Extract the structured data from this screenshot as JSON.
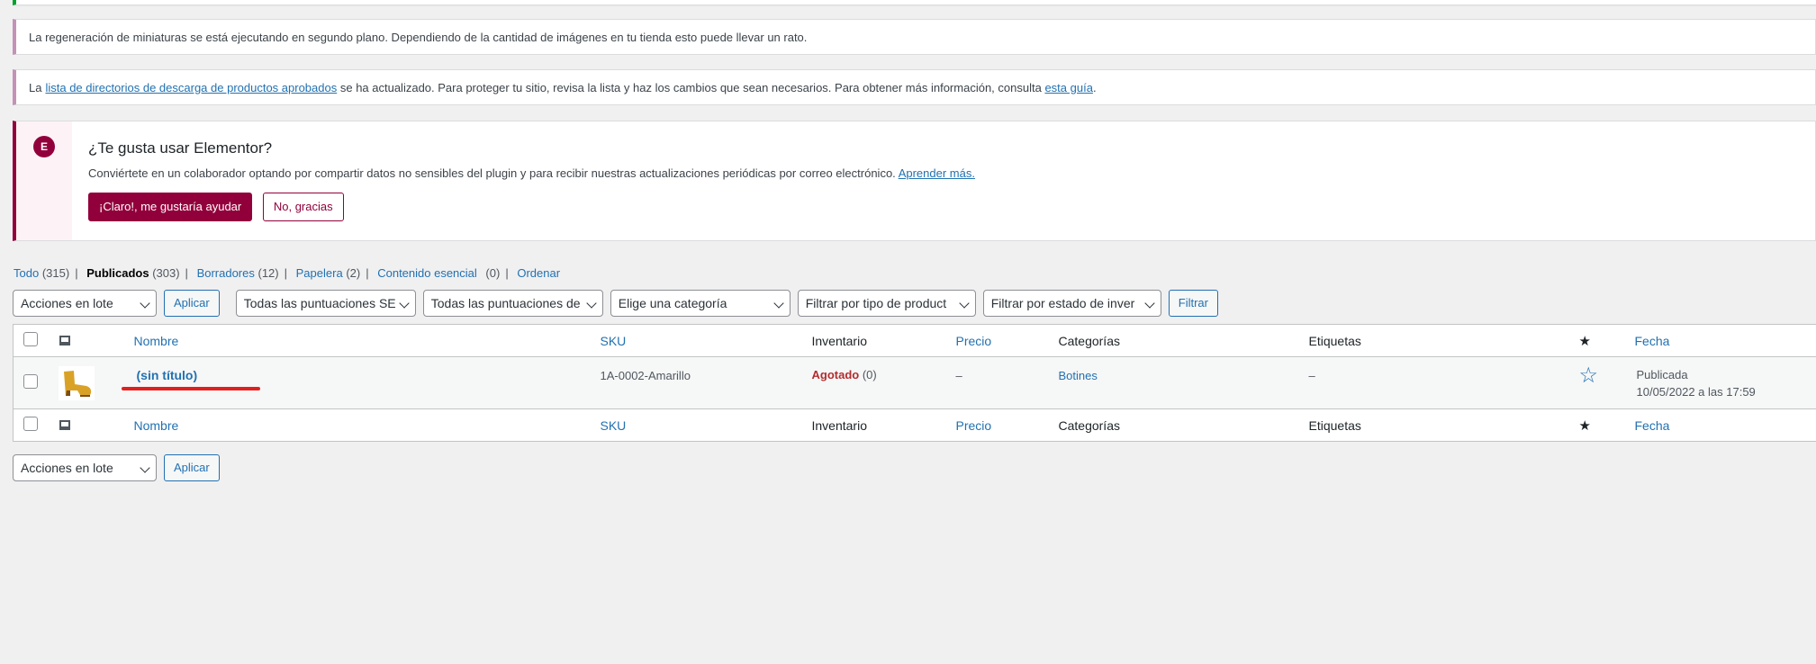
{
  "notices": {
    "thumbnail": "La regeneración de miniaturas se está ejecutando en segundo plano. Dependiendo de la cantidad de imágenes en tu tienda esto puede llevar un rato.",
    "downloads_prefix": "La ",
    "downloads_link": "lista de directorios de descarga de productos aprobados",
    "downloads_middle": " se ha actualizado. Para proteger tu sitio, revisa la lista y haz los cambios que sean necesarios. Para obtener más información, consulta ",
    "downloads_guide": "esta guía",
    "downloads_suffix": "."
  },
  "elementor": {
    "logo": "E",
    "title": "¿Te gusta usar Elementor?",
    "description": "Conviértete en un colaborador optando por compartir datos no sensibles del plugin y para recibir nuestras actualizaciones periódicas por correo electrónico. ",
    "learn_more": "Aprender más.",
    "accept": "¡Claro!, me gustaría ayudar",
    "decline": "No, gracias"
  },
  "views": [
    {
      "label": "Todo",
      "count": "(315)"
    },
    {
      "label": "Publicados",
      "count": "(303)"
    },
    {
      "label": "Borradores",
      "count": "(12)"
    },
    {
      "label": "Papelera",
      "count": "(2)"
    },
    {
      "label": "Contenido esencial",
      "count": "(0)"
    },
    {
      "label": "Ordenar",
      "count": ""
    }
  ],
  "filters": {
    "bulk": "Acciones en lote",
    "apply": "Aplicar",
    "ratings1": "Todas las puntuaciones SE",
    "ratings2": "Todas las puntuaciones de",
    "category": "Elige una categoría",
    "product_type": "Filtrar por tipo de product",
    "stock_status": "Filtrar por estado de inver",
    "filter": "Filtrar"
  },
  "columns": {
    "name": "Nombre",
    "sku": "SKU",
    "stock": "Inventario",
    "price": "Precio",
    "categories": "Categorías",
    "tags": "Etiquetas",
    "featured": "★",
    "date": "Fecha"
  },
  "rows": [
    {
      "name": "(sin título)",
      "sku": "1A-0002-Amarillo",
      "stock_status": "Agotado",
      "stock_count": "(0)",
      "price": "–",
      "category": "Botines",
      "tags": "–",
      "featured": "☆",
      "date_status": "Publicada",
      "date": "10/05/2022 a las 17:59"
    }
  ],
  "bottom": {
    "bulk": "Acciones en lote",
    "apply": "Aplicar"
  },
  "colors": {
    "link": "#2271b1",
    "elementor": "#92003b",
    "out_of_stock": "#b32d2e",
    "annotation": "#e0201e"
  }
}
